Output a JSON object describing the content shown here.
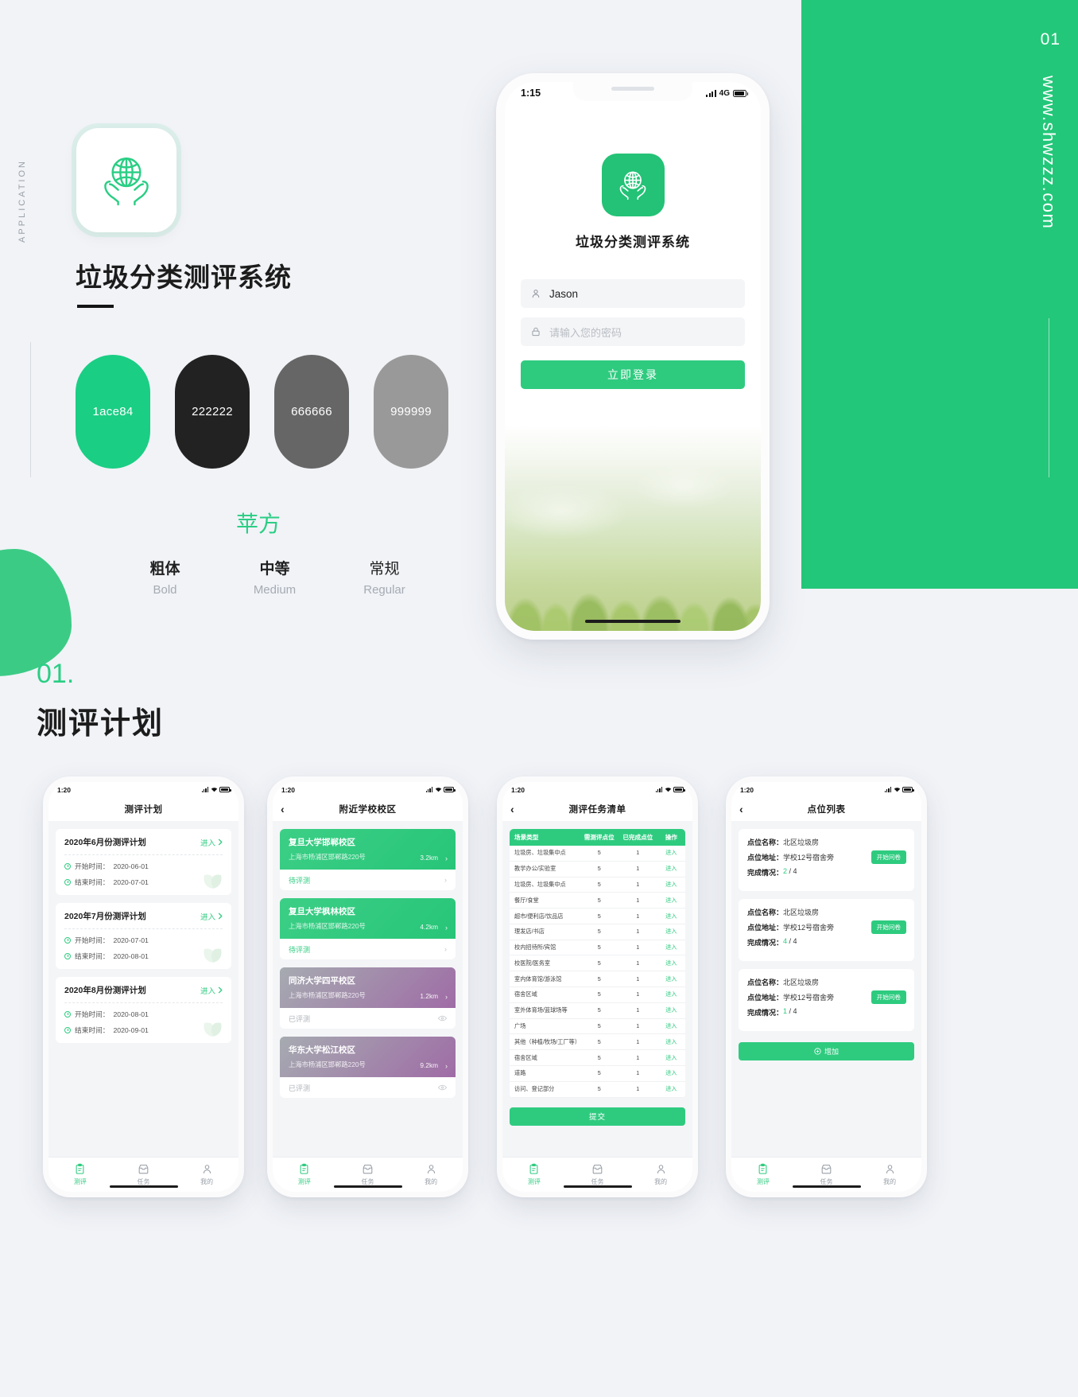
{
  "branding": {
    "vertical_label": "APPLICATION",
    "app_title": "垃圾分类测评系统",
    "app_icon_name": "globe-in-hands-icon"
  },
  "panel": {
    "number": "01",
    "url": "www.shwzzz.com"
  },
  "swatches": [
    {
      "hex": "#1ace84",
      "label": "1ace84",
      "text_color": "#ffffff"
    },
    {
      "hex": "#222222",
      "label": "222222",
      "text_color": "#ffffff"
    },
    {
      "hex": "#666666",
      "label": "666666",
      "text_color": "#ffffff"
    },
    {
      "hex": "#999999",
      "label": "999999",
      "text_color": "#ffffff"
    }
  ],
  "typography": {
    "family_name": "苹方",
    "weights": [
      {
        "cn": "粗体",
        "en": "Bold"
      },
      {
        "cn": "中等",
        "en": "Medium"
      },
      {
        "cn": "常规",
        "en": "Regular"
      }
    ]
  },
  "section": {
    "number": "01.",
    "title": "测评计划"
  },
  "hero_phone": {
    "status": {
      "time": "1:15",
      "network": "4G"
    },
    "app_name": "垃圾分类测评系统",
    "username_value": "Jason",
    "password_placeholder": "请输入您的密码",
    "login_label": "立即登录"
  },
  "tabbar": {
    "items": [
      {
        "label": "测评",
        "icon": "clipboard-icon",
        "active": true
      },
      {
        "label": "任务",
        "icon": "inbox-icon",
        "active": false
      },
      {
        "label": "我的",
        "icon": "user-icon",
        "active": false
      }
    ]
  },
  "screen_plans": {
    "status_time": "1:20",
    "nav_title": "测评计划",
    "enter_label": "进入",
    "start_label": "开始时间：",
    "end_label": "结束时间：",
    "cards": [
      {
        "title": "2020年6月份测评计划",
        "start": "2020-06-01",
        "end": "2020-07-01"
      },
      {
        "title": "2020年7月份测评计划",
        "start": "2020-07-01",
        "end": "2020-08-01"
      },
      {
        "title": "2020年8月份测评计划",
        "start": "2020-08-01",
        "end": "2020-09-01"
      }
    ]
  },
  "screen_campus": {
    "status_time": "1:20",
    "nav_title": "附近学校校区",
    "cards": [
      {
        "name": "复旦大学邯郸校区",
        "address": "上海市杨浦区邯郸路220号",
        "distance": "3.2km",
        "status": "待评测",
        "state": "pending"
      },
      {
        "name": "复旦大学枫林校区",
        "address": "上海市杨浦区邯郸路220号",
        "distance": "4.2km",
        "status": "待评测",
        "state": "pending"
      },
      {
        "name": "同济大学四平校区",
        "address": "上海市杨浦区邯郸路220号",
        "distance": "1.2km",
        "status": "已评测",
        "state": "done"
      },
      {
        "name": "华东大学松江校区",
        "address": "上海市杨浦区邯郸路220号",
        "distance": "9.2km",
        "status": "已评测",
        "state": "done"
      }
    ]
  },
  "screen_tasks": {
    "status_time": "1:20",
    "nav_title": "测评任务清单",
    "columns": [
      "场景类型",
      "需测评点位",
      "已完成点位",
      "操作"
    ],
    "rows": [
      [
        "垃圾房、垃圾集中点",
        "5",
        "1",
        "进入"
      ],
      [
        "教学办公/实验室",
        "5",
        "1",
        "进入"
      ],
      [
        "垃圾房、垃圾集中点",
        "5",
        "1",
        "进入"
      ],
      [
        "餐厅/食堂",
        "5",
        "1",
        "进入"
      ],
      [
        "超市/便利店/饮品店",
        "5",
        "1",
        "进入"
      ],
      [
        "理发店/书店",
        "5",
        "1",
        "进入"
      ],
      [
        "校内招待所/宾馆",
        "5",
        "1",
        "进入"
      ],
      [
        "校医院/医务室",
        "5",
        "1",
        "进入"
      ],
      [
        "室内体育馆/游泳馆",
        "5",
        "1",
        "进入"
      ],
      [
        "宿舍区域",
        "5",
        "1",
        "进入"
      ],
      [
        "室外体育场/篮球场等",
        "5",
        "1",
        "进入"
      ],
      [
        "广场",
        "5",
        "1",
        "进入"
      ],
      [
        "其他（种植/牧场/工厂等）",
        "5",
        "1",
        "进入"
      ],
      [
        "宿舍区域",
        "5",
        "1",
        "进入"
      ],
      [
        "道路",
        "5",
        "1",
        "进入"
      ],
      [
        "访问、登记部分",
        "5",
        "1",
        "进入"
      ]
    ],
    "submit_label": "提交"
  },
  "screen_points": {
    "status_time": "1:20",
    "nav_title": "点位列表",
    "labels": {
      "name": "点位名称：",
      "address": "点位地址：",
      "progress": "完成情况："
    },
    "action_label": "开始问卷",
    "add_label": "增加",
    "cards": [
      {
        "name": "北区垃圾房",
        "address": "学校12号宿舍旁",
        "done": "2",
        "total": "4"
      },
      {
        "name": "北区垃圾房",
        "address": "学校12号宿舍旁",
        "done": "4",
        "total": "4"
      },
      {
        "name": "北区垃圾房",
        "address": "学校12号宿舍旁",
        "done": "1",
        "total": "4"
      }
    ]
  }
}
